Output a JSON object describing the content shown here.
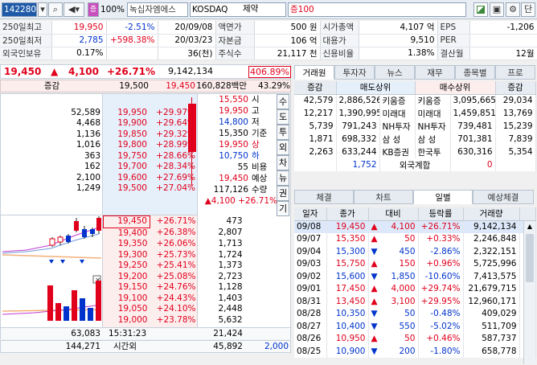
{
  "toolbar": {
    "code": "142280",
    "stock_name": "녹십자엠에스",
    "zoom": "100%",
    "market": "KOSDAQ",
    "sector": "제약",
    "margin": "증100",
    "btn_dan": "단"
  },
  "info": [
    [
      "250일최고",
      "19,950",
      "-2.51%",
      "20/09/08",
      "액면가",
      "500 원",
      "시가총액",
      "4,107 억",
      "EPS",
      "-1,206"
    ],
    [
      "250일최저",
      "2,785",
      "+598.38%",
      "20/03/23",
      "자본금",
      "106 억",
      "대용가",
      "9,510",
      "PER",
      ""
    ],
    [
      "외국인보유",
      "0.17%",
      "",
      "36(천)",
      "주식수",
      "21,117 천",
      "신용비율",
      "1.38%",
      "결산월",
      "12월"
    ]
  ],
  "price_bar": {
    "price": "19,450",
    "arrow": "▲",
    "change": "4,100",
    "rate": "+26.71%",
    "volume": "9,142,134",
    "ratio": "406.89%"
  },
  "ob_header": {
    "label": "증감",
    "ask_total": "19,500",
    "bid_total": "19,450",
    "amount": "160,828백만",
    "pct": "43.29%"
  },
  "asks": [
    {
      "chg": "",
      "qty": "",
      "price": "",
      "rate": ""
    },
    {
      "chg": "",
      "qty": "52,589",
      "price": "19,950",
      "rate": "+29.97%"
    },
    {
      "chg": "",
      "qty": "4,468",
      "price": "19,900",
      "rate": "+29.64%"
    },
    {
      "chg": "",
      "qty": "1,136",
      "price": "19,850",
      "rate": "+29.32%"
    },
    {
      "chg": "",
      "qty": "1,016",
      "price": "19,800",
      "rate": "+28.99%"
    },
    {
      "chg": "",
      "qty": "363",
      "price": "19,750",
      "rate": "+28.66%"
    },
    {
      "chg": "",
      "qty": "162",
      "price": "19,700",
      "rate": "+28.34%"
    },
    {
      "chg": "",
      "qty": "2,100",
      "price": "19,600",
      "rate": "+27.69%"
    },
    {
      "chg": "",
      "qty": "1,249",
      "price": "19,500",
      "rate": "+27.04%"
    }
  ],
  "bids": [
    {
      "price": "19,450",
      "rate": "+26.71%",
      "qty": "473"
    },
    {
      "price": "19,400",
      "rate": "+26.38%",
      "qty": "2,807"
    },
    {
      "price": "19,350",
      "rate": "+26.06%",
      "qty": "1,713"
    },
    {
      "price": "19,300",
      "rate": "+25.73%",
      "qty": "1,724"
    },
    {
      "price": "19,250",
      "rate": "+25.41%",
      "qty": "1,373"
    },
    {
      "price": "19,200",
      "rate": "+25.08%",
      "qty": "2,723"
    },
    {
      "price": "19,150",
      "rate": "+24.76%",
      "qty": "1,128"
    },
    {
      "price": "19,100",
      "rate": "+24.43%",
      "qty": "1,403"
    },
    {
      "price": "19,050",
      "rate": "+24.10%",
      "qty": "2,448"
    },
    {
      "price": "19,000",
      "rate": "+23.78%",
      "qty": "5,632"
    }
  ],
  "summary": [
    {
      "v": "15,550",
      "k": "시"
    },
    {
      "v": "19,950",
      "k": "고"
    },
    {
      "v": "14,800",
      "k": "저"
    },
    {
      "v": "15,350",
      "k": "기준"
    },
    {
      "v": "19,950",
      "k": "상"
    },
    {
      "v": "10,750",
      "k": "하"
    },
    {
      "v": "55",
      "k": "비용"
    },
    {
      "v": "19,450",
      "k": "예상"
    },
    {
      "v": "117,126",
      "k": "수량"
    },
    {
      "v": "▲4,100 +26.71%",
      "k": ""
    }
  ],
  "side_buttons": [
    "수",
    "도",
    "투",
    "외",
    "차",
    "뉴",
    "권",
    "기"
  ],
  "ob_footer": {
    "ask_sum": "63,083",
    "time": "15:31:23",
    "bid_sum": "21,424",
    "vol": "144,271",
    "time_label": "시간외",
    "after_qty": "45,892",
    "after_price": "2,000"
  },
  "broker_tabs": [
    "거래원",
    "투자자",
    "뉴스",
    "재무",
    "종목별",
    "프로"
  ],
  "broker_header": [
    "증감",
    "매도상위",
    "매수상위",
    "증감"
  ],
  "brokers": [
    {
      "c1": "42,579",
      "q1": "2,886,526",
      "n1": "키움증",
      "n2": "키움증",
      "q2": "3,095,665",
      "c2": "29,034"
    },
    {
      "c1": "12,217",
      "q1": "1,390,995",
      "n1": "미래대",
      "n2": "미래대",
      "q2": "1,459,851",
      "c2": "13,769"
    },
    {
      "c1": "5,739",
      "q1": "791,243",
      "n1": "NH투자",
      "n2": "NH투자",
      "q2": "739,481",
      "c2": "15,239"
    },
    {
      "c1": "1,871",
      "q1": "698,332",
      "n1": "삼 성",
      "n2": "삼 성",
      "q2": "701,381",
      "c2": "7,839"
    },
    {
      "c1": "2,263",
      "q1": "633,244",
      "n1": "KB증권",
      "n2": "한국투",
      "q2": "630,316",
      "c2": "5,354"
    }
  ],
  "foreign": {
    "sell": "1,752",
    "label": "외국계합",
    "buy": "0"
  },
  "daily_tabs": [
    "체결",
    "차트",
    "일별",
    "예상체결"
  ],
  "daily_header": [
    "일자",
    "종가",
    "대비",
    "등락률",
    "거래량"
  ],
  "daily": [
    {
      "d": "09/08",
      "p": "19,450",
      "dir": "up",
      "c": "4,100",
      "r": "+26.71%",
      "v": "9,142,134"
    },
    {
      "d": "09/07",
      "p": "15,350",
      "dir": "up",
      "c": "50",
      "r": "+0.33%",
      "v": "2,246,848"
    },
    {
      "d": "09/04",
      "p": "15,300",
      "dir": "down",
      "c": "450",
      "r": "-2.86%",
      "v": "2,322,151"
    },
    {
      "d": "09/03",
      "p": "15,750",
      "dir": "up",
      "c": "150",
      "r": "+0.96%",
      "v": "5,725,996"
    },
    {
      "d": "09/02",
      "p": "15,600",
      "dir": "down",
      "c": "1,850",
      "r": "-10.60%",
      "v": "7,413,575"
    },
    {
      "d": "09/01",
      "p": "17,450",
      "dir": "up",
      "c": "4,000",
      "r": "+29.74%",
      "v": "21,679,715"
    },
    {
      "d": "08/31",
      "p": "13,450",
      "dir": "up",
      "c": "3,100",
      "r": "+29.95%",
      "v": "12,960,171"
    },
    {
      "d": "08/28",
      "p": "10,350",
      "dir": "down",
      "c": "50",
      "r": "-0.48%",
      "v": "409,029"
    },
    {
      "d": "08/27",
      "p": "10,400",
      "dir": "down",
      "c": "550",
      "r": "-5.02%",
      "v": "511,709"
    },
    {
      "d": "08/26",
      "p": "10,950",
      "dir": "up",
      "c": "50",
      "r": "+0.46%",
      "v": "587,737"
    },
    {
      "d": "08/25",
      "p": "10,900",
      "dir": "down",
      "c": "200",
      "r": "-1.80%",
      "v": "658,778"
    }
  ],
  "colors": {
    "up": "#e0001b",
    "down": "#0033cc",
    "ask_bg": "#e6f0fb",
    "bid_bg": "#fdeeee"
  }
}
